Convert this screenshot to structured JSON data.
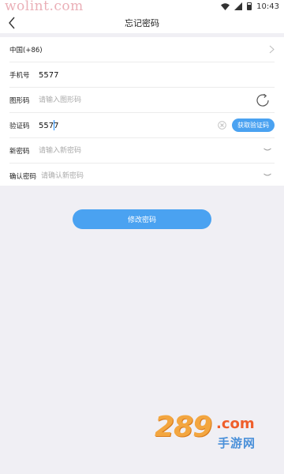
{
  "status_bar": {
    "watermark": "wolint.com",
    "time": "10:43"
  },
  "nav": {
    "title": "忘记密码"
  },
  "form": {
    "region": {
      "label": "中国(+86)"
    },
    "phone": {
      "label": "手机号",
      "value": "5577"
    },
    "captcha": {
      "label": "图形码",
      "placeholder": "请输入图形码"
    },
    "sms_code": {
      "label": "验证码",
      "value": "5577",
      "button": "获取验证码"
    },
    "new_password": {
      "label": "新密码",
      "placeholder": "请输入新密码"
    },
    "confirm_password": {
      "label": "确认密码",
      "placeholder": "请确认新密码"
    }
  },
  "submit": {
    "label": "修改密码"
  },
  "logo_watermark": {
    "number": "289",
    "dotcom": ".com",
    "sub": "手游网"
  },
  "colors": {
    "accent": "#4aa2f1",
    "page_bg": "#f0eff4",
    "logo_orange": "#f3a640",
    "logo_blue": "#4a90d9"
  },
  "icons": [
    "back-icon",
    "chevron-right-icon",
    "refresh-icon",
    "clear-icon",
    "eye-closed-icon",
    "wifi-icon",
    "signal-icon",
    "battery-icon"
  ]
}
